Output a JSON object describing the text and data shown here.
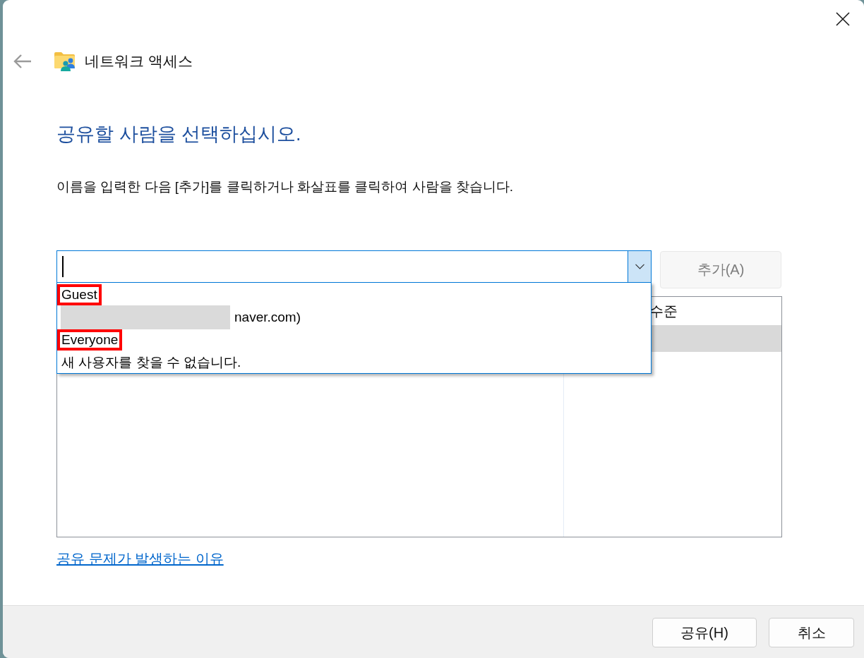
{
  "window": {
    "title": "네트워크 액세스"
  },
  "heading": "공유할 사람을 선택하십시오.",
  "instruction": "이름을 입력한 다음 [추가]를 클릭하거나 화살표를 클릭하여 사람을 찾습니다.",
  "name_combo": {
    "expanded": true,
    "options": [
      {
        "text": "Guest",
        "highlighted": true,
        "redacted": false
      },
      {
        "text": "naver.com)",
        "highlighted": false,
        "redacted": true
      },
      {
        "text": "Everyone",
        "highlighted": true,
        "redacted": false
      },
      {
        "text": "새 사용자를 찾을 수 없습니다.",
        "highlighted": false,
        "redacted": false
      }
    ]
  },
  "add_button": {
    "label": "추가(A)",
    "disabled": true
  },
  "permissions_table": {
    "column_2_header": "수준",
    "rows": [
      {
        "selected": true
      }
    ]
  },
  "help_link": "공유 문제가 발생하는 이유",
  "buttons": [
    {
      "label": "공유(H)"
    },
    {
      "label": "취소"
    }
  ]
}
